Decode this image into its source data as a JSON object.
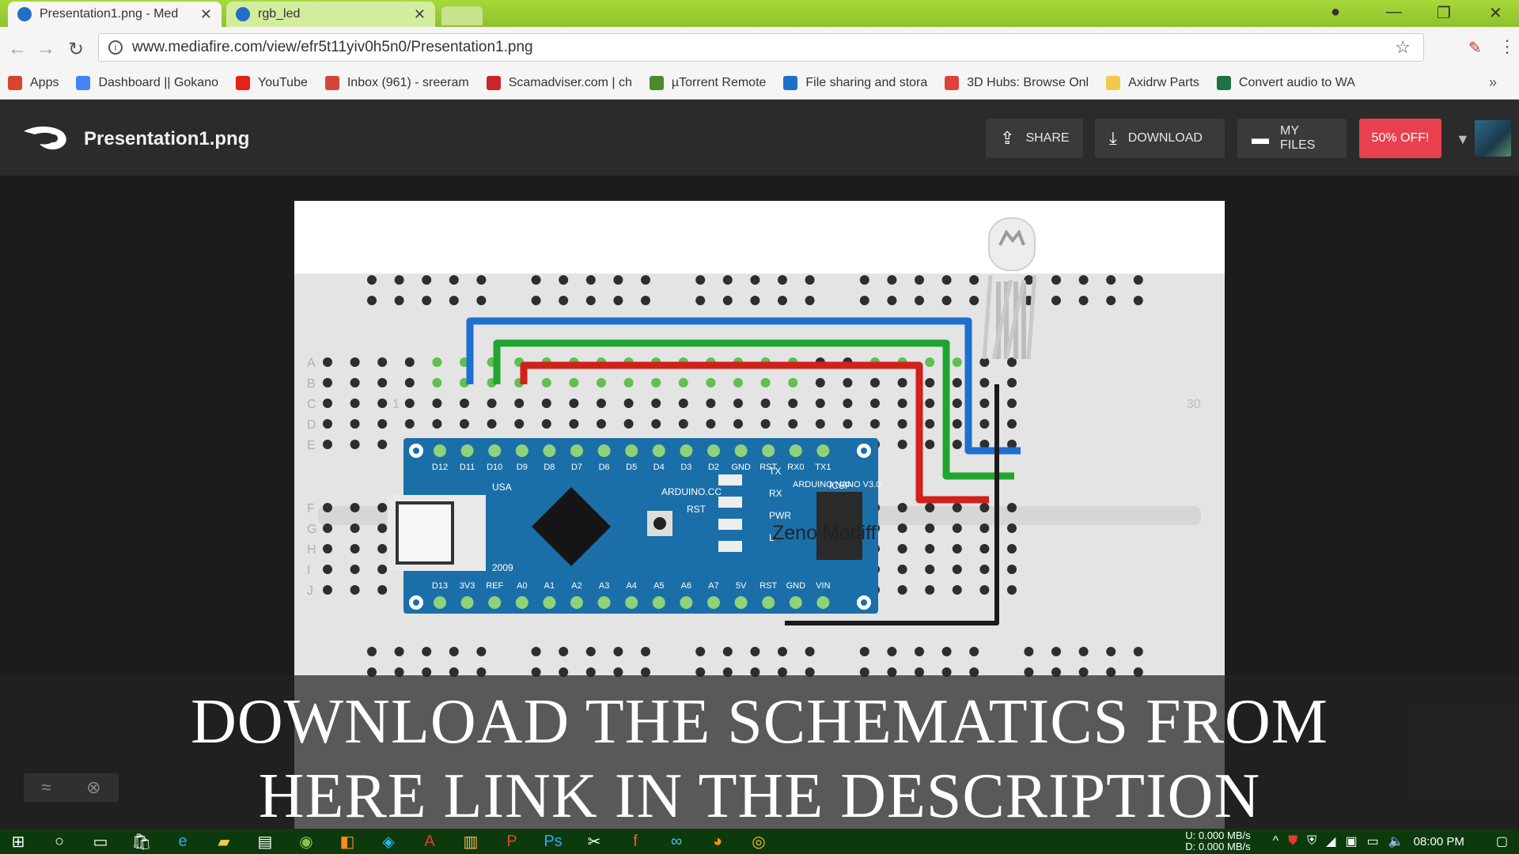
{
  "browser": {
    "tabs": [
      {
        "title": "Presentation1.png - Med",
        "active": true
      },
      {
        "title": "rgb_led",
        "active": false
      }
    ],
    "url": "www.mediafire.com/view/efr5t11yiv0h5n0/Presentation1.png",
    "bookmarks": [
      {
        "label": "Apps",
        "icon": "apps-grid-icon",
        "color": "#d8442e"
      },
      {
        "label": "Dashboard || Gokano",
        "icon": "google-icon",
        "color": "#4285f4"
      },
      {
        "label": "YouTube",
        "icon": "youtube-icon",
        "color": "#e62117"
      },
      {
        "label": "Inbox (961) - sreeram",
        "icon": "gmail-icon",
        "color": "#d44638"
      },
      {
        "label": "Scamadviser.com | ch",
        "icon": "shield-icon",
        "color": "#c62828"
      },
      {
        "label": "µTorrent Remote",
        "icon": "utorrent-icon",
        "color": "#4b8b2e"
      },
      {
        "label": "File sharing and stora",
        "icon": "mediafire-icon",
        "color": "#1f6fc4"
      },
      {
        "label": "3D Hubs: Browse Onl",
        "icon": "3dhubs-icon",
        "color": "#e0403a"
      },
      {
        "label": "Axidrw Parts",
        "icon": "folder-icon",
        "color": "#f2c94c"
      },
      {
        "label": "Convert audio to WA",
        "icon": "excel-icon",
        "color": "#1e7145"
      }
    ]
  },
  "mediafire": {
    "file_title": "Presentation1.png",
    "share_label": "SHARE",
    "download_label": "DOWNLOAD",
    "myfiles_label": "MY FILES",
    "offer_label": "50% OFF!"
  },
  "image": {
    "board_top_labels": [
      "D12",
      "D11",
      "D10",
      "D9",
      "D8",
      "D7",
      "D6",
      "D5",
      "D4",
      "D3",
      "D2",
      "GND",
      "RST",
      "RX0",
      "TX1"
    ],
    "board_bottom_labels": [
      "D13",
      "3V3",
      "REF",
      "A0",
      "A1",
      "A2",
      "A3",
      "A4",
      "A5",
      "A6",
      "A7",
      "5V",
      "RST",
      "GND",
      "VIN"
    ],
    "board_text": {
      "arduino_cc": "ARDUINO.CC",
      "model": "ARDUINO NANO V3.0",
      "usa": "USA",
      "year": "2009",
      "icsp": "ICSP",
      "rst": "RST",
      "pwr": "PWR",
      "tx": "TX",
      "rx": "RX",
      "l": "L"
    },
    "row_letters": [
      "A",
      "B",
      "C",
      "D",
      "E",
      "F",
      "G",
      "H",
      "I",
      "J"
    ],
    "col_labels": [
      "1",
      "30"
    ],
    "watermark": "Zeno Modiff"
  },
  "caption": {
    "line1": "DOWNLOAD THE SCHEMATICS FROM",
    "line2": "HERE LINK IN THE DESCRIPTION"
  },
  "taskbar": {
    "net_up": "U:    0.000 MB/s",
    "net_down": "D:    0.000 MB/s",
    "time": "08:00 PM"
  },
  "colors": {
    "wire_blue": "#1e6fd0",
    "wire_green": "#1fa62e",
    "wire_red": "#d0211a",
    "wire_black": "#1a1a1a",
    "board_blue": "#1b6fa8",
    "offer": "#e8404f"
  }
}
